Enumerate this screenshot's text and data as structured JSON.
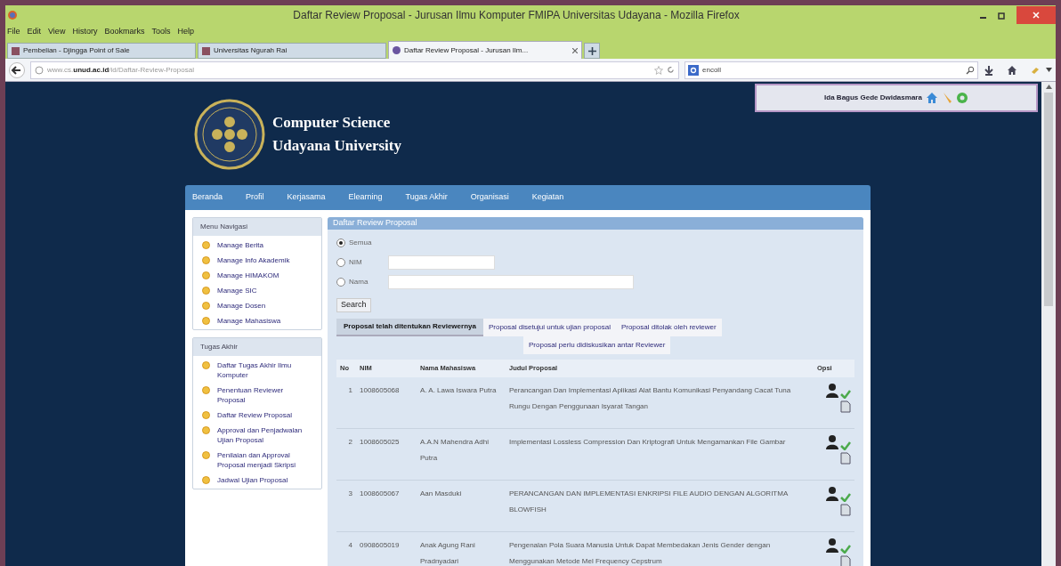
{
  "window": {
    "title": "Daftar Review Proposal - Jurusan Ilmu Komputer FMIPA Universitas Udayana - Mozilla Firefox"
  },
  "menu": [
    "File",
    "Edit",
    "View",
    "History",
    "Bookmarks",
    "Tools",
    "Help"
  ],
  "browser_tabs": [
    {
      "label": "Pembelian - Djingga Point of Sale",
      "selected": false
    },
    {
      "label": "Universitas Ngurah Rai",
      "selected": false
    },
    {
      "label": "Daftar Review Proposal - Jurusan Ilm...",
      "selected": true
    }
  ],
  "address_bar": {
    "host": "www.cs.",
    "domain": "unud.ac.id",
    "path": "/id/Daftar-Review-Proposal"
  },
  "search_bar": {
    "value": "encoll"
  },
  "user_box": {
    "name": "Ida Bagus Gede Dwidasmara"
  },
  "site": {
    "title_line_1": "Computer Science",
    "title_line_2": "Udayana University"
  },
  "nav": [
    "Beranda",
    "Profil",
    "Kerjasama",
    "Elearning",
    "Tugas Akhir",
    "Organisasi",
    "Kegiatan"
  ],
  "sidebar": [
    {
      "title": "Menu Navigasi",
      "items": [
        "Manage Berita",
        "Manage Info Akademik",
        "Manage HIMAKOM",
        "Manage SIC",
        "Manage Dosen",
        "Manage Mahasiswa"
      ]
    },
    {
      "title": "Tugas Akhir",
      "items": [
        "Daftar Tugas Akhir Ilmu Komputer",
        "Penentuan Reviewer Proposal",
        "Daftar Review Proposal",
        "Approval dan Penjadwalan Ujian Proposal",
        "Penilaian dan Approval Proposal menjadi Skripsi",
        "Jadwal Ujian Proposal"
      ]
    }
  ],
  "panel": {
    "title": "Daftar Review Proposal",
    "filters": [
      {
        "label": "Semua",
        "selected": true,
        "kind": "plain"
      },
      {
        "label": "NIM",
        "selected": false,
        "kind": "short_input"
      },
      {
        "label": "Nama",
        "selected": false,
        "kind": "long_input"
      }
    ],
    "search_button": "Search",
    "tabs": [
      {
        "label": "Proposal telah ditentukan Reviewernya",
        "selected": true
      },
      {
        "label": "Proposal disetujui untuk ujian proposal",
        "selected": false
      },
      {
        "label": "Proposal ditolak oleh reviewer",
        "selected": false
      },
      {
        "label": "Proposal perlu didiskusikan antar Reviewer",
        "selected": false
      }
    ],
    "table": {
      "columns": [
        "No",
        "NIM",
        "Nama Mahasiswa",
        "Judul Proposal",
        "Opsi"
      ],
      "rows": [
        {
          "no": "1",
          "nim": "1008605068",
          "nama": "A. A. Lawa Iswara Putra",
          "judul": "Perancangan Dan Implementasi Aplikasi Alat Bantu Komunikasi Penyandang Cacat Tuna Rungu Dengan Penggunaan Isyarat Tangan"
        },
        {
          "no": "2",
          "nim": "1008605025",
          "nama": "A.A.N Mahendra Adhi Putra",
          "judul": "Implementasi Lossless Compression Dan Kriptografi Untuk Mengamankan File Gambar"
        },
        {
          "no": "3",
          "nim": "1008605067",
          "nama": "Aan Masduki",
          "judul": "PERANCANGAN DAN IMPLEMENTASI ENKRIPSI FILE AUDIO DENGAN ALGORITMA BLOWFISH"
        },
        {
          "no": "4",
          "nim": "0908605019",
          "nama": "Anak Agung Rani Pradnyadari",
          "judul": "Pengenalan Pola Suara Manusia Untuk Dapat Membedakan Jenis Gender dengan Menggunakan Metode Mel Frequency Cepstrum"
        }
      ]
    }
  }
}
